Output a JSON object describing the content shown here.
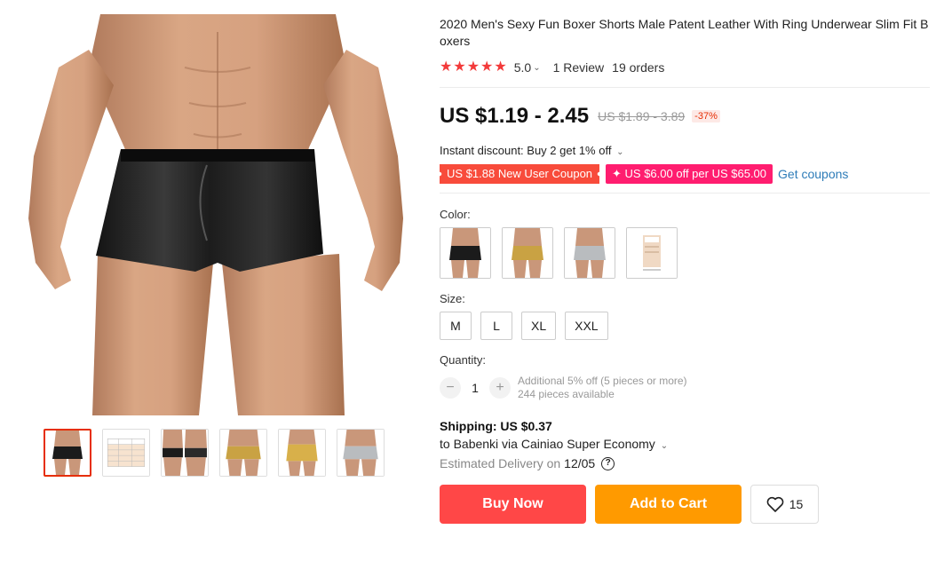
{
  "product": {
    "title": "2020 Men's Sexy Fun Boxer Shorts Male Patent Leather With Ring Underwear Slim Fit Boxers",
    "rating_value": "5.0",
    "reviews": "1 Review",
    "orders": "19 orders"
  },
  "price": {
    "current": "US $1.19 - 2.45",
    "original": "US $1.89 - 3.89",
    "discount_pct": "-37%"
  },
  "promotions": {
    "instant_discount": "Instant discount: Buy 2 get 1% off",
    "coupon_new_user": "US $1.88 New User Coupon",
    "coupon_store": "✦ US $6.00 off per US $65.00",
    "get_coupons": "Get coupons"
  },
  "options": {
    "color_label": "Color:",
    "colors": [
      "black",
      "gold",
      "silver",
      "size-chart"
    ],
    "size_label": "Size:",
    "sizes": [
      "M",
      "L",
      "XL",
      "XXL"
    ]
  },
  "quantity": {
    "label": "Quantity:",
    "value": "1",
    "note_discount": "Additional 5% off (5 pieces or more)",
    "note_available": "244 pieces available"
  },
  "shipping": {
    "cost": "Shipping: US $0.37",
    "destination": "to Babenki via Cainiao Super Economy",
    "delivery_label": "Estimated Delivery on",
    "delivery_date": "12/05"
  },
  "actions": {
    "buy_now": "Buy Now",
    "add_to_cart": "Add to Cart",
    "wishlist_count": "15"
  },
  "gallery": {
    "thumbnails": [
      "black-front",
      "size-chart",
      "black-multi",
      "gold-front",
      "gold-side",
      "silver-front"
    ],
    "active_index": 0
  },
  "colors": {
    "accent_red": "#ff4747",
    "accent_orange": "#ff9a00",
    "coupon_red": "#f84b3b",
    "coupon_pink": "#ff1d6f",
    "link_blue": "#2e7cb8",
    "star_red": "#f33a3a"
  }
}
